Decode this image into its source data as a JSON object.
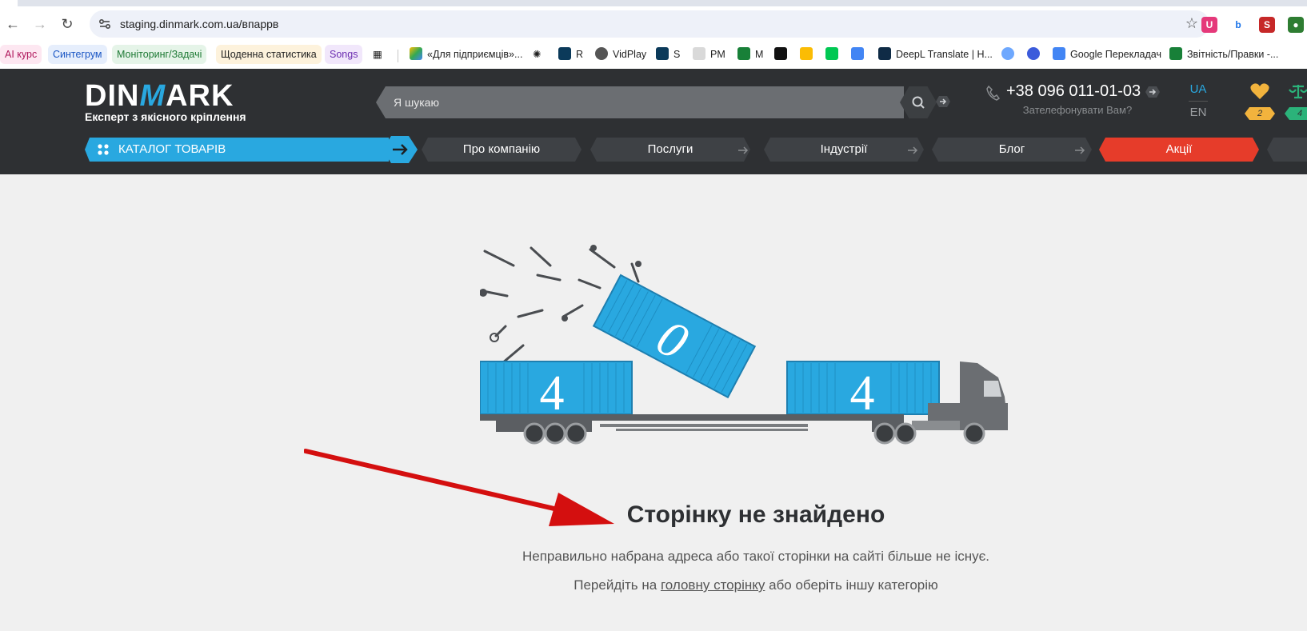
{
  "browser": {
    "url": "staging.dinmark.com.ua/впаррв",
    "bookmarks": [
      {
        "label": "AI курс"
      },
      {
        "label": "Синтегрум"
      },
      {
        "label": "Моніторинг/Задачі"
      },
      {
        "label": "Щоденна статистика"
      },
      {
        "label": "Songs"
      },
      {
        "label": "«Для підприємців»..."
      },
      {
        "label": "R"
      },
      {
        "label": "VidPlay"
      },
      {
        "label": "S"
      },
      {
        "label": "PM"
      },
      {
        "label": "M"
      },
      {
        "label": "DeepL Translate | H..."
      },
      {
        "label": "Google Перекладач"
      },
      {
        "label": "Звітність/Правки -..."
      }
    ]
  },
  "header": {
    "logo_word": "DINMARK",
    "logo_m": "M",
    "logo_left": "DIN",
    "logo_right": "ARK",
    "tagline": "Експерт з якісного кріплення",
    "search_placeholder": "Я шукаю",
    "phone": "+38 096 011-01-03",
    "callback": "Зателефонувати Вам?",
    "lang_ua": "UA",
    "lang_en": "EN",
    "favorites_count": "2",
    "compare_count": "4"
  },
  "nav": {
    "catalog": "КАТАЛОГ ТОВАРІВ",
    "items": [
      "Про компанію",
      "Послуги",
      "Індустрії",
      "Блог",
      "Акції"
    ]
  },
  "error": {
    "digits": [
      "4",
      "0",
      "4"
    ],
    "title": "Сторінку не знайдено",
    "message": "Неправильно набрана адреса або такої сторінки на сайті більше не існує.",
    "go_prefix": "Перейдіть на",
    "home_link": "головну сторінку",
    "go_suffix": "або оберіть іншу категорію"
  },
  "colors": {
    "brand_blue": "#29a8e0",
    "header_bg": "#2e3033",
    "promo_red": "#e63c2a",
    "annotation_arrow": "#d40f0f"
  }
}
